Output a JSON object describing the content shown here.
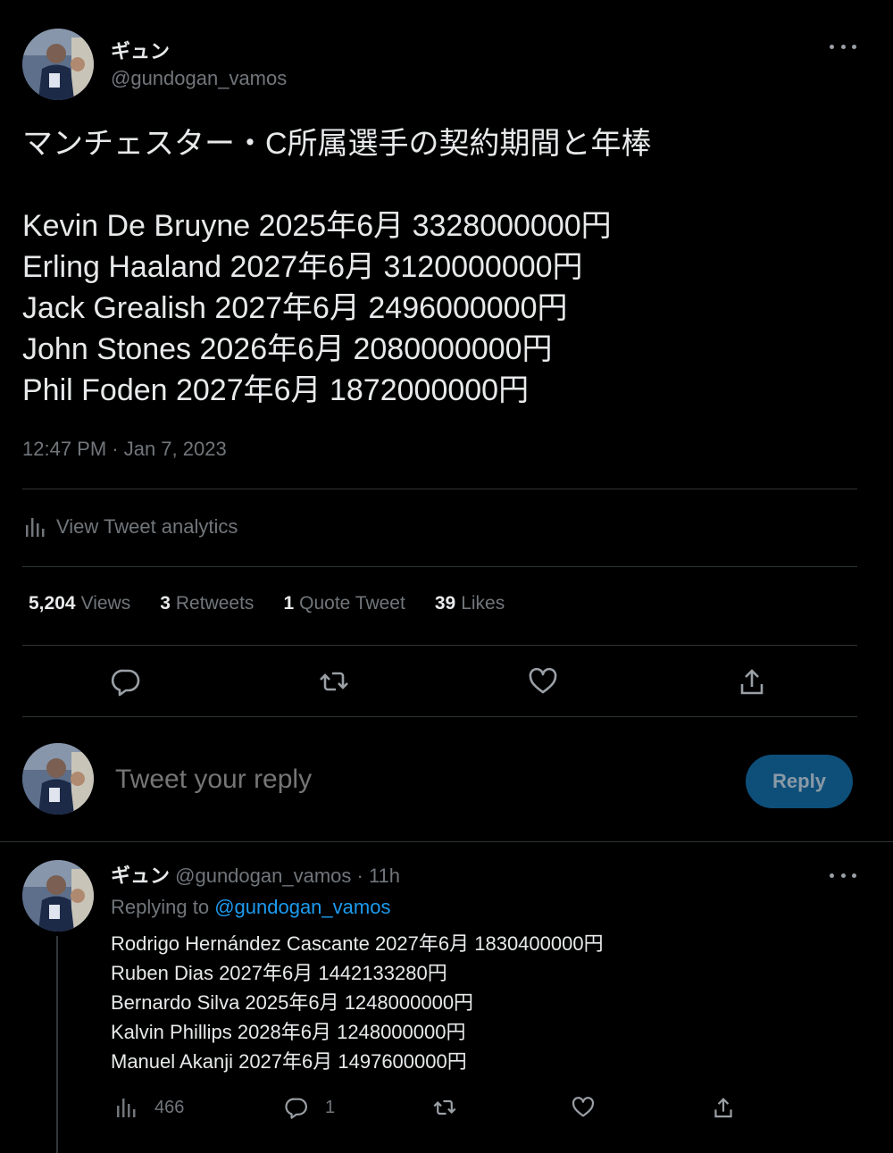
{
  "main_tweet": {
    "display_name": "ギュン",
    "handle": "@gundogan_vamos",
    "title": "マンチェスター・C所属選手の契約期間と年棒",
    "lines": [
      "Kevin De Bruyne 2025年6月 3328000000円",
      "Erling Haaland 2027年6月 3120000000円",
      "Jack Grealish 2027年6月 2496000000円",
      "John Stones 2026年6月 2080000000円",
      "Phil Foden 2027年6月 1872000000円"
    ],
    "timestamp": "12:47 PM · Jan 7, 2023",
    "analytics_label": "View Tweet analytics",
    "stats": {
      "views_count": "5,204",
      "views_label": "Views",
      "retweets_count": "3",
      "retweets_label": "Retweets",
      "quotes_count": "1",
      "quotes_label": "Quote Tweet",
      "likes_count": "39",
      "likes_label": "Likes"
    }
  },
  "reply_box": {
    "placeholder": "Tweet your reply",
    "button_label": "Reply"
  },
  "reply_tweet": {
    "display_name": "ギュン",
    "handle": "@gundogan_vamos",
    "time": "· 11h",
    "replying_prefix": "Replying to",
    "replying_handle": "@gundogan_vamos",
    "lines": [
      "Rodrigo Hernández Cascante 2027年6月 1830400000円",
      "Ruben Dias 2027年6月 1442133280円",
      "Bernardo Silva 2025年6月 1248000000円",
      "Kalvin Phillips 2028年6月 1248000000円",
      "Manuel Akanji 2027年6月 1497600000円"
    ],
    "views_count": "466",
    "replies_count": "1"
  },
  "colors": {
    "background": "#000000",
    "text": "#e7e9ea",
    "muted": "#71767b",
    "link": "#1d9bf0",
    "divider": "#2f3336",
    "reply_button_bg": "#0e4f7a"
  },
  "icons": {
    "more": "more-dots-icon",
    "analytics": "bar-chart-icon",
    "reply": "speech-bubble-icon",
    "retweet": "retweet-arrows-icon",
    "like": "heart-icon",
    "share": "share-upload-icon"
  }
}
